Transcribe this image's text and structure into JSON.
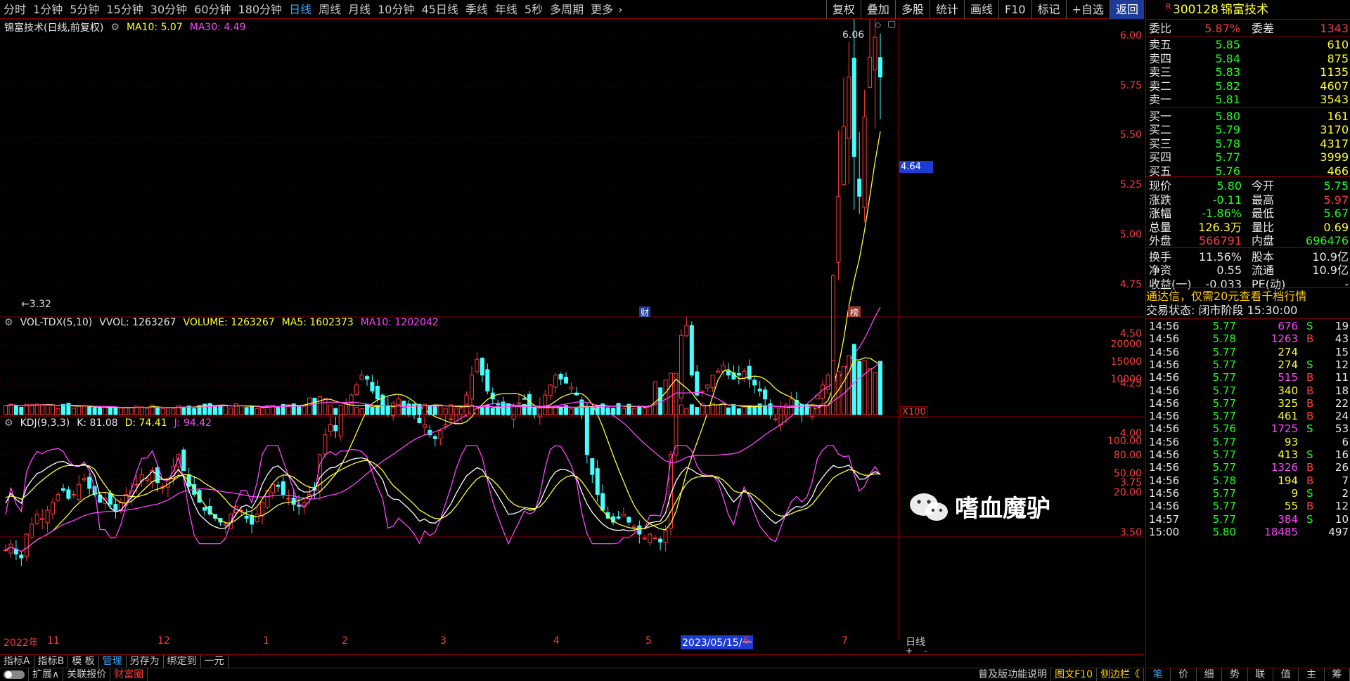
{
  "toolbar": {
    "tabs": [
      "分时",
      "1分钟",
      "5分钟",
      "15分钟",
      "30分钟",
      "60分钟",
      "180分钟",
      "日线",
      "周线",
      "月线",
      "10分钟",
      "45日线",
      "季线",
      "年线",
      "5秒",
      "多周期",
      "更多"
    ],
    "active": "日线",
    "right_buttons": [
      "复权",
      "叠加",
      "多股",
      "统计",
      "画线",
      "F10",
      "标记",
      "+自选",
      "返回"
    ]
  },
  "main_legend": {
    "title": "锦富技术(日线,前复权)",
    "ma10": "MA10: 5.07",
    "ma30": "MA30: 4.49"
  },
  "vol_legend": {
    "title": "VOL-TDX(5,10)",
    "vvol": "VVOL: 1263267",
    "volume": "VOLUME: 1263267",
    "ma5": "MA5: 1602373",
    "ma10": "MA10: 1202042"
  },
  "kdj_legend": {
    "title": "KDJ(9,3,3)",
    "k": "K: 81.08",
    "d": "D: 74.41",
    "j": "J: 94.42"
  },
  "price_axis": [
    "6.00",
    "5.75",
    "5.50",
    "5.25",
    "5.00",
    "4.75",
    "4.50",
    "4.25",
    "4.00",
    "3.75",
    "3.50"
  ],
  "price_marker": "4.64",
  "high_label": "6.06",
  "low_label": "3.32",
  "vol_axis": [
    "20000",
    "15000",
    "10000"
  ],
  "vol_unit": "X100",
  "kdj_axis": [
    "100.00",
    "80.00",
    "50.00",
    "20.00"
  ],
  "event_labels": {
    "cai": "财",
    "bang": "榜"
  },
  "time_axis": [
    "2022年",
    "11",
    "12",
    "1",
    "2",
    "3",
    "4",
    "5",
    "2023/05/15/一",
    "6",
    "7"
  ],
  "period_label": "日线",
  "zoom": {
    "plus": "+",
    "minus": "-"
  },
  "bottom_buttons": [
    "指标A",
    "指标B",
    "模 板",
    "管理",
    "另存为",
    "绑定到",
    "一元"
  ],
  "bottom_active": "管理",
  "status_buttons": [
    "扩展∧",
    "关联报价",
    "财富圈"
  ],
  "status_right": [
    "普及版功能说明",
    "图文F10",
    "侧边栏《"
  ],
  "quote": {
    "code": "300128",
    "name": "锦富技术",
    "r_flag": "R",
    "weibi_label": "委比",
    "weibi": "5.87%",
    "weicha_label": "委差",
    "weicha": "1343",
    "sells": [
      {
        "label": "卖五",
        "price": "5.85",
        "vol": "610"
      },
      {
        "label": "卖四",
        "price": "5.84",
        "vol": "875"
      },
      {
        "label": "卖三",
        "price": "5.83",
        "vol": "1135"
      },
      {
        "label": "卖二",
        "price": "5.82",
        "vol": "4607"
      },
      {
        "label": "卖一",
        "price": "5.81",
        "vol": "3543"
      }
    ],
    "buys": [
      {
        "label": "买一",
        "price": "5.80",
        "vol": "161"
      },
      {
        "label": "买二",
        "price": "5.79",
        "vol": "3170"
      },
      {
        "label": "买三",
        "price": "5.78",
        "vol": "4317"
      },
      {
        "label": "买四",
        "price": "5.77",
        "vol": "3999"
      },
      {
        "label": "买五",
        "price": "5.76",
        "vol": "466"
      }
    ],
    "stats": [
      {
        "l1": "现价",
        "v1": "5.80",
        "c1": "g",
        "l2": "今开",
        "v2": "5.75",
        "c2": "g"
      },
      {
        "l1": "涨跌",
        "v1": "-0.11",
        "c1": "g",
        "l2": "最高",
        "v2": "5.97",
        "c2": "r"
      },
      {
        "l1": "涨幅",
        "v1": "-1.86%",
        "c1": "g",
        "l2": "最低",
        "v2": "5.67",
        "c2": "g"
      },
      {
        "l1": "总量",
        "v1": "126.3万",
        "c1": "y",
        "l2": "量比",
        "v2": "0.69",
        "c2": "y"
      },
      {
        "l1": "外盘",
        "v1": "566791",
        "c1": "r",
        "l2": "内盘",
        "v2": "696476",
        "c2": "g"
      }
    ],
    "stats2": [
      {
        "l1": "换手",
        "v1": "11.56%",
        "l2": "股本",
        "v2": "10.9亿"
      },
      {
        "l1": "净资",
        "v1": "0.55",
        "l2": "流通",
        "v2": "10.9亿"
      },
      {
        "l1": "收益(一)",
        "v1": "-0.033",
        "l2": "PE(动)",
        "v2": "-"
      }
    ],
    "promo": "通达信，仅需20元查看千档行情",
    "trade_status": "交易状态: 闭市阶段 15:30:00",
    "ticks": [
      {
        "t": "14:56",
        "p": "5.77",
        "pc": "g",
        "v": "676",
        "vc": "m",
        "s": "S",
        "n": "19"
      },
      {
        "t": "14:56",
        "p": "5.78",
        "pc": "g",
        "v": "1263",
        "vc": "m",
        "s": "B",
        "n": "43"
      },
      {
        "t": "14:56",
        "p": "5.77",
        "pc": "g",
        "v": "274",
        "vc": "y",
        "s": "",
        "n": "15"
      },
      {
        "t": "14:56",
        "p": "5.77",
        "pc": "g",
        "v": "274",
        "vc": "y",
        "s": "S",
        "n": "12"
      },
      {
        "t": "14:56",
        "p": "5.77",
        "pc": "g",
        "v": "515",
        "vc": "m",
        "s": "B",
        "n": "11"
      },
      {
        "t": "14:56",
        "p": "5.77",
        "pc": "g",
        "v": "340",
        "vc": "y",
        "s": "B",
        "n": "18"
      },
      {
        "t": "14:56",
        "p": "5.77",
        "pc": "g",
        "v": "325",
        "vc": "y",
        "s": "B",
        "n": "22"
      },
      {
        "t": "14:56",
        "p": "5.77",
        "pc": "g",
        "v": "461",
        "vc": "y",
        "s": "B",
        "n": "24"
      },
      {
        "t": "14:56",
        "p": "5.76",
        "pc": "g",
        "v": "1725",
        "vc": "m",
        "s": "S",
        "n": "53"
      },
      {
        "t": "14:56",
        "p": "5.77",
        "pc": "g",
        "v": "93",
        "vc": "y",
        "s": "",
        "n": "6"
      },
      {
        "t": "14:56",
        "p": "5.77",
        "pc": "g",
        "v": "413",
        "vc": "y",
        "s": "S",
        "n": "16"
      },
      {
        "t": "14:56",
        "p": "5.77",
        "pc": "g",
        "v": "1326",
        "vc": "m",
        "s": "B",
        "n": "26"
      },
      {
        "t": "14:56",
        "p": "5.78",
        "pc": "g",
        "v": "194",
        "vc": "y",
        "s": "B",
        "n": "7"
      },
      {
        "t": "14:56",
        "p": "5.77",
        "pc": "g",
        "v": "9",
        "vc": "y",
        "s": "S",
        "n": "2"
      },
      {
        "t": "14:56",
        "p": "5.77",
        "pc": "g",
        "v": "55",
        "vc": "y",
        "s": "B",
        "n": "12"
      },
      {
        "t": "14:57",
        "p": "5.77",
        "pc": "g",
        "v": "384",
        "vc": "m",
        "s": "S",
        "n": "10"
      },
      {
        "t": "15:00",
        "p": "5.80",
        "pc": "g",
        "v": "18485",
        "vc": "m",
        "s": "",
        "n": "497"
      }
    ],
    "bottom_tabs": [
      "笔",
      "价",
      "细",
      "势",
      "联",
      "值",
      "主",
      "筹"
    ]
  },
  "watermark": "嗜血魔驴",
  "colors": {
    "up": "#ff3b3b",
    "down": "#44ffff",
    "ma10": "#ffff33",
    "ma30": "#ff44ff",
    "k": "#ffffff",
    "d": "#ffff33",
    "j": "#ff44ff",
    "grid": "#8b0000"
  },
  "chart_data": [
    {
      "type": "candlestick",
      "title": "锦富技术(日线,前复权)",
      "note": "approximate daily closes Oct-2022 to Jul-2023",
      "ylim": [
        3.3,
        6.1
      ],
      "closes": [
        3.42,
        3.45,
        3.4,
        3.38,
        3.5,
        3.55,
        3.6,
        3.58,
        3.62,
        3.66,
        3.7,
        3.72,
        3.68,
        3.7,
        3.75,
        3.78,
        3.73,
        3.7,
        3.66,
        3.68,
        3.65,
        3.62,
        3.66,
        3.7,
        3.72,
        3.75,
        3.8,
        3.78,
        3.82,
        3.76,
        3.74,
        3.78,
        3.84,
        3.9,
        3.82,
        3.74,
        3.7,
        3.66,
        3.62,
        3.6,
        3.58,
        3.56,
        3.55,
        3.6,
        3.64,
        3.62,
        3.58,
        3.55,
        3.6,
        3.66,
        3.72,
        3.75,
        3.74,
        3.7,
        3.68,
        3.65,
        3.64,
        3.66,
        3.7,
        3.72,
        3.9,
        4.0,
        4.05,
        4.02,
        4.1,
        4.15,
        4.2,
        4.25,
        4.3,
        4.28,
        4.22,
        4.18,
        4.15,
        4.12,
        4.16,
        4.18,
        4.14,
        4.12,
        4.1,
        4.06,
        4.05,
        4.0,
        3.98,
        4.02,
        4.05,
        4.08,
        4.1,
        4.12,
        4.2,
        4.3,
        4.38,
        4.3,
        4.22,
        4.18,
        4.15,
        4.12,
        4.1,
        4.14,
        4.16,
        4.18,
        4.12,
        4.1,
        4.14,
        4.2,
        4.25,
        4.3,
        4.28,
        4.26,
        4.24,
        4.2,
        4.1,
        3.9,
        3.8,
        3.7,
        3.62,
        3.58,
        3.56,
        3.58,
        3.6,
        3.56,
        3.54,
        3.5,
        3.48,
        3.5,
        3.48,
        3.46,
        3.52,
        3.9,
        4.2,
        4.5,
        4.55,
        4.3,
        4.2,
        4.22,
        4.25,
        4.3,
        4.32,
        4.35,
        4.3,
        4.28,
        4.3,
        4.32,
        4.28,
        4.25,
        4.22,
        4.18,
        4.1,
        4.08,
        4.12,
        4.15,
        4.18,
        4.14,
        4.1,
        4.12,
        4.15,
        4.2,
        4.25,
        4.3,
        4.8,
        5.2,
        5.55,
        5.8,
        5.4,
        5.2,
        5.6,
        5.9,
        6.0,
        5.8
      ]
    },
    {
      "type": "bar",
      "title": "VOL-TDX(5,10)",
      "ylim": [
        0,
        22000
      ],
      "note": "volume in hundreds"
    },
    {
      "type": "line",
      "title": "KDJ(9,3,3)",
      "series": [
        {
          "name": "K",
          "last": 81.08
        },
        {
          "name": "D",
          "last": 74.41
        },
        {
          "name": "J",
          "last": 94.42
        }
      ],
      "ylim": [
        0,
        110
      ]
    }
  ]
}
